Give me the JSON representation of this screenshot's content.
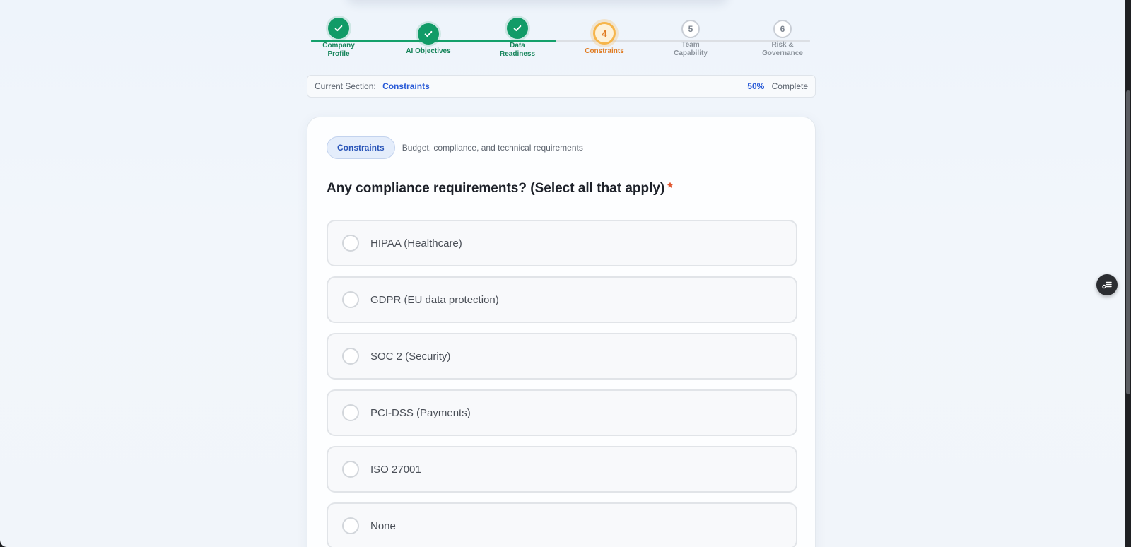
{
  "stepper": {
    "progress_fraction": 0.5,
    "steps": [
      {
        "number": "1",
        "label_line1": "Company",
        "label_line2": "Profile",
        "status": "done"
      },
      {
        "number": "2",
        "label_line1": "AI Objectives",
        "label_line2": "",
        "status": "done"
      },
      {
        "number": "3",
        "label_line1": "Data",
        "label_line2": "Readiness",
        "status": "done"
      },
      {
        "number": "4",
        "label_line1": "Constraints",
        "label_line2": "",
        "status": "active"
      },
      {
        "number": "5",
        "label_line1": "Team",
        "label_line2": "Capability",
        "status": "todo"
      },
      {
        "number": "6",
        "label_line1": "Risk &",
        "label_line2": "Governance",
        "status": "todo"
      }
    ]
  },
  "section_bar": {
    "prefix": "Current Section:",
    "name": "Constraints",
    "percent": "50%",
    "complete_label": "Complete"
  },
  "card": {
    "badge": "Constraints",
    "badge_description": "Budget, compliance, and technical requirements",
    "question": "Any compliance requirements? (Select all that apply)",
    "required_mark": "*",
    "options": [
      {
        "label": "HIPAA (Healthcare)",
        "selected": false
      },
      {
        "label": "GDPR (EU data protection)",
        "selected": false
      },
      {
        "label": "SOC 2 (Security)",
        "selected": false
      },
      {
        "label": "PCI-DSS (Payments)",
        "selected": false
      },
      {
        "label": "ISO 27001",
        "selected": false
      },
      {
        "label": "None",
        "selected": false
      }
    ]
  },
  "colors": {
    "done": "#119b67",
    "active": "#e07b22",
    "accent": "#2a5bd7",
    "required": "#e0562f"
  },
  "icons": {
    "step_done": "check-icon",
    "floating_button": "settings-toggle-icon"
  }
}
